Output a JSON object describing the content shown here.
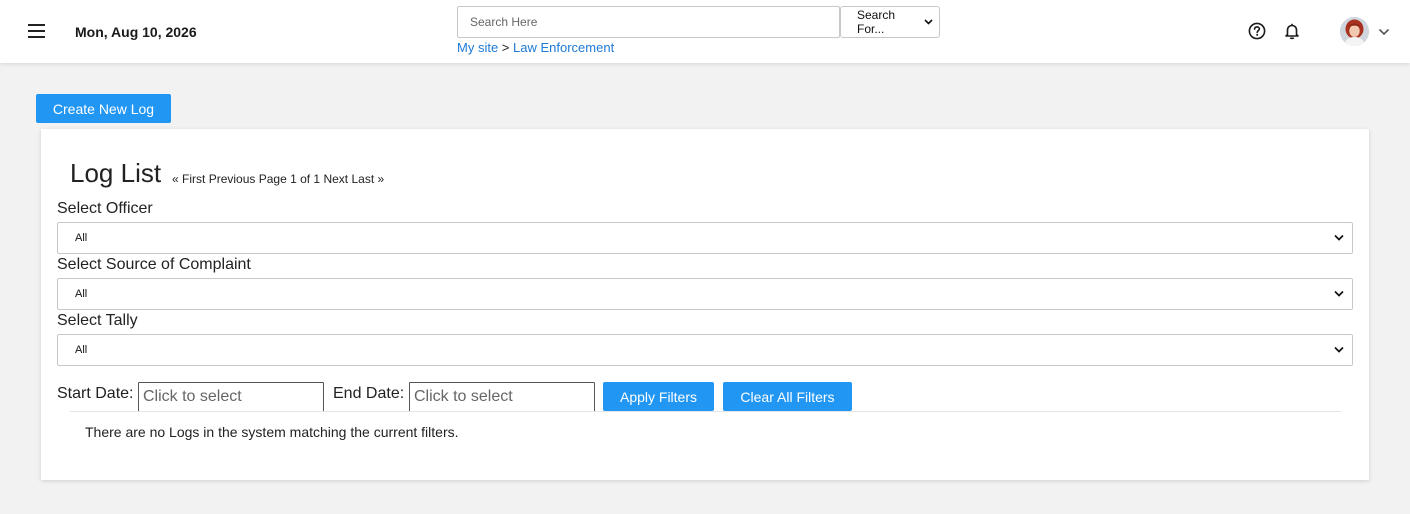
{
  "header": {
    "date": "Mon, Aug 10, 2026",
    "search": {
      "placeholder": "Search Here",
      "type_selected": "Search For..."
    },
    "breadcrumb": {
      "site": "My site",
      "separator": ">",
      "section": "Law Enforcement"
    }
  },
  "actions": {
    "create_label": "Create New Log"
  },
  "log_list": {
    "title": "Log List",
    "pager": {
      "first": "« First",
      "previous": "Previous",
      "page_text": "Page 1 of 1",
      "next": "Next",
      "last": "Last »"
    },
    "filters": {
      "officer": {
        "label": "Select Officer",
        "value": "All"
      },
      "source": {
        "label": "Select Source of Complaint",
        "value": "All"
      },
      "tally": {
        "label": "Select Tally",
        "value": "All"
      },
      "start_date": {
        "label": "Start Date:",
        "placeholder": "Click to select"
      },
      "end_date": {
        "label": "End Date:",
        "placeholder": "Click to select"
      },
      "apply_label": "Apply Filters",
      "clear_label": "Clear All Filters"
    },
    "empty_message": "There are no Logs in the system matching the current filters."
  },
  "colors": {
    "accent": "#2196f3",
    "link": "#1f7ad6",
    "background": "#f2f2f2"
  }
}
